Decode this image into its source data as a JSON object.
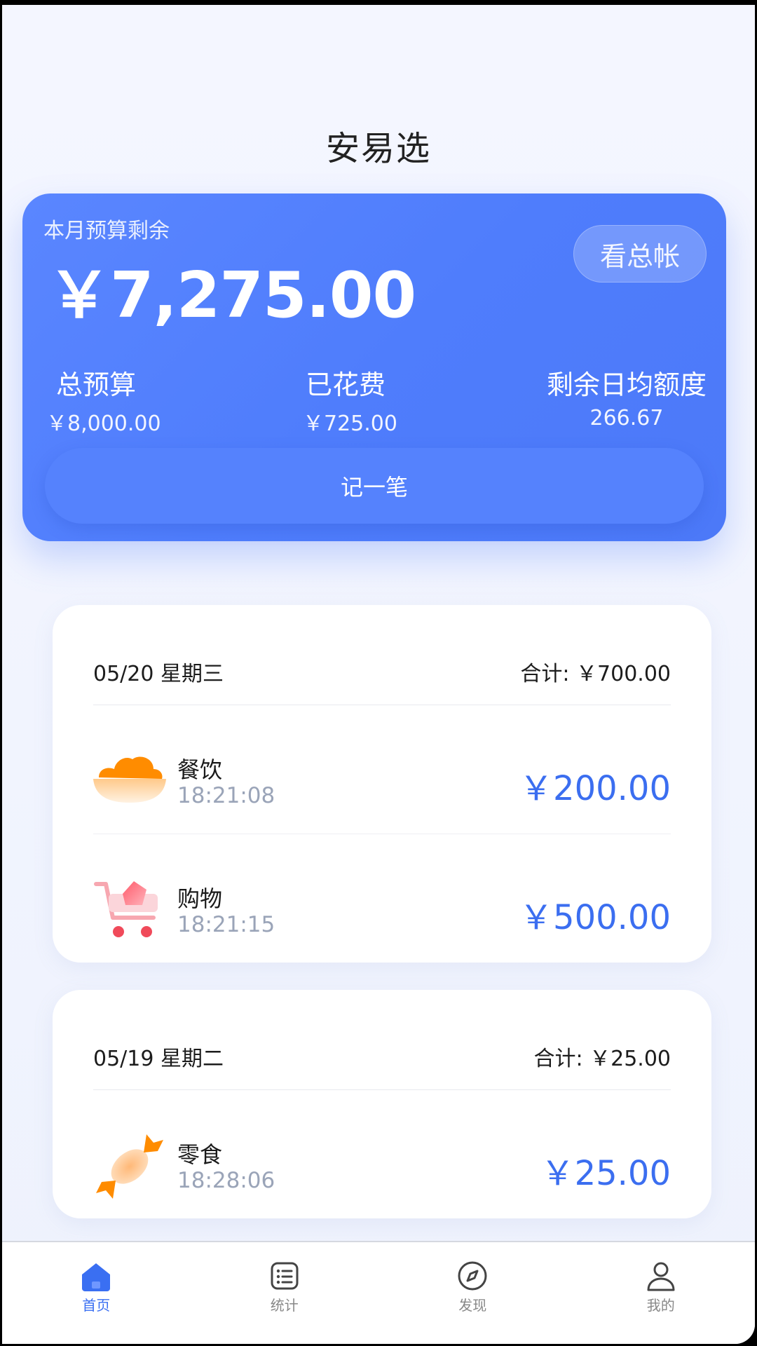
{
  "app": {
    "title": "安易选"
  },
  "budget": {
    "label": "本月预算剩余",
    "remaining": "￥7,275.00",
    "summary_button": "看总帐",
    "stats": [
      {
        "label": "总预算",
        "value": "￥8,000.00"
      },
      {
        "label": "已花费",
        "value": "￥725.00"
      },
      {
        "label": "剩余日均额度",
        "value": "266.67"
      }
    ],
    "record_button": "记一笔"
  },
  "days": [
    {
      "date": "05/20 星期三",
      "total": "合计: ￥700.00",
      "entries": [
        {
          "category": "餐饮",
          "time": "18:21:08",
          "amount": "￥200.00",
          "icon": "food-bowl-icon"
        },
        {
          "category": "购物",
          "time": "18:21:15",
          "amount": "￥500.00",
          "icon": "shopping-cart-icon"
        }
      ]
    },
    {
      "date": "05/19 星期二",
      "total": "合计: ￥25.00",
      "entries": [
        {
          "category": "零食",
          "time": "18:28:06",
          "amount": "￥25.00",
          "icon": "candy-icon"
        }
      ]
    }
  ],
  "nav": [
    {
      "label": "首页",
      "icon": "home-icon",
      "active": true
    },
    {
      "label": "统计",
      "icon": "list-icon",
      "active": false
    },
    {
      "label": "发现",
      "icon": "compass-icon",
      "active": false
    },
    {
      "label": "我的",
      "icon": "user-icon",
      "active": false
    }
  ],
  "colors": {
    "primary": "#4f7dfc",
    "amount": "#3b6ef0",
    "accent_orange": "#ff8c00",
    "accent_red": "#f04a5a"
  }
}
